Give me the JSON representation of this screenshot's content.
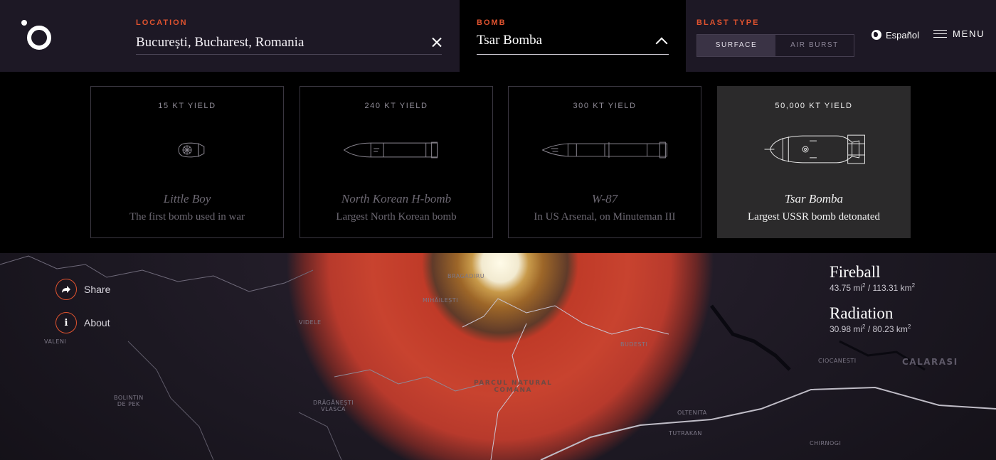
{
  "header": {
    "location_label": "LOCATION",
    "location_value": "București, Bucharest, Romania",
    "bomb_label": "BOMB",
    "bomb_value": "Tsar Bomba",
    "blast_type_label": "BLAST TYPE",
    "blast_options": [
      "SURFACE",
      "AIR BURST"
    ],
    "blast_selected": "SURFACE",
    "language": "Español",
    "menu_label": "MENU"
  },
  "bombs": [
    {
      "yield": "15 KT YIELD",
      "name": "Little Boy",
      "desc": "The first bomb used in war",
      "icon": "little-boy-icon"
    },
    {
      "yield": "240 KT YIELD",
      "name": "North Korean H-bomb",
      "desc": "Largest North Korean bomb",
      "icon": "north-korean-hbomb-icon"
    },
    {
      "yield": "300 KT YIELD",
      "name": "W-87",
      "desc": "In US Arsenal, on Minuteman III",
      "icon": "w87-icon"
    },
    {
      "yield": "50,000 KT YIELD",
      "name": "Tsar Bomba",
      "desc": "Largest USSR bomb detonated",
      "icon": "tsar-bomba-icon",
      "selected": true
    }
  ],
  "sidebar": {
    "share_label": "Share",
    "about_label": "About",
    "about_glyph": "i"
  },
  "effects": [
    {
      "name": "Fireball",
      "mi": "43.75 mi",
      "km": " / 113.31 km"
    },
    {
      "name": "Radiation",
      "mi": "30.98 mi",
      "km": " / 80.23 km"
    }
  ],
  "effects_unit_exp": "2",
  "map_labels": {
    "bragadiru": "BRAGADIRU",
    "mihailesti": "MIHĂILEȘTI",
    "videle": "VIDELE",
    "valeni": "VALENI",
    "budesti": "BUDESTI",
    "park": "PARCUL NATURAL\nCOMANA",
    "calarasi": "CALARASI",
    "ciocanesti": "CIOCANESTI",
    "draganesti": "DRĂGĂNEȘTI\nVLASCA",
    "oltenita": "OLTENITA",
    "tutrakan": "TUTRAKAN",
    "chirnogi": "CHIRNOGI",
    "bolintin": "BOLINTIN\nDE PEK"
  },
  "colors": {
    "accent": "#e0532f",
    "topbar": "#1d1825",
    "fireball": "#fffbe8",
    "blast": "#c8432f"
  }
}
